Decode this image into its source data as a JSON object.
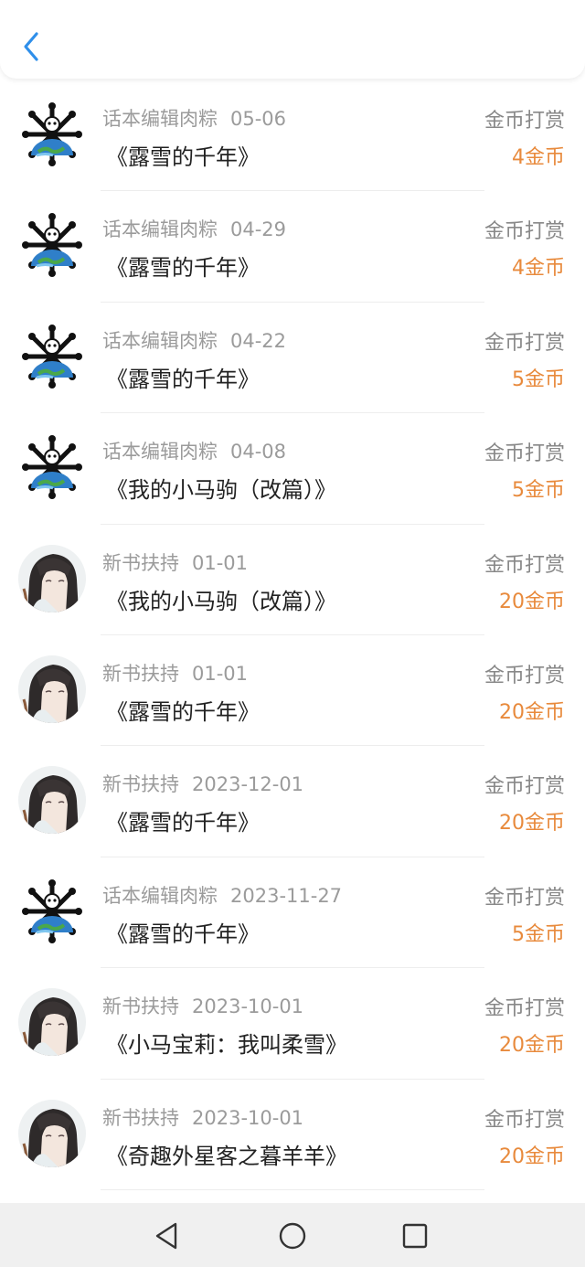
{
  "header": {
    "back_icon": "chevron-left-icon"
  },
  "colors": {
    "accent": "#2f8fea",
    "amount": "#e88a3c",
    "meta": "#9b9b9b"
  },
  "rewards": [
    {
      "avatar": "skull-globe-avatar",
      "sender": "话本编辑肉粽",
      "date": "05-06",
      "book": "《露雪的千年》",
      "type": "金币打赏",
      "amount": "4金币"
    },
    {
      "avatar": "skull-globe-avatar",
      "sender": "话本编辑肉粽",
      "date": "04-29",
      "book": "《露雪的千年》",
      "type": "金币打赏",
      "amount": "4金币"
    },
    {
      "avatar": "skull-globe-avatar",
      "sender": "话本编辑肉粽",
      "date": "04-22",
      "book": "《露雪的千年》",
      "type": "金币打赏",
      "amount": "5金币"
    },
    {
      "avatar": "skull-globe-avatar",
      "sender": "话本编辑肉粽",
      "date": "04-08",
      "book": "《我的小马驹（改篇）》",
      "type": "金币打赏",
      "amount": "5金币"
    },
    {
      "avatar": "anime-portrait-avatar",
      "sender": "新书扶持",
      "date": "01-01",
      "book": "《我的小马驹（改篇）》",
      "type": "金币打赏",
      "amount": "20金币"
    },
    {
      "avatar": "anime-portrait-avatar",
      "sender": "新书扶持",
      "date": "01-01",
      "book": "《露雪的千年》",
      "type": "金币打赏",
      "amount": "20金币"
    },
    {
      "avatar": "anime-portrait-avatar",
      "sender": "新书扶持",
      "date": "2023-12-01",
      "book": "《露雪的千年》",
      "type": "金币打赏",
      "amount": "20金币"
    },
    {
      "avatar": "skull-globe-avatar",
      "sender": "话本编辑肉粽",
      "date": "2023-11-27",
      "book": "《露雪的千年》",
      "type": "金币打赏",
      "amount": "5金币"
    },
    {
      "avatar": "anime-portrait-avatar",
      "sender": "新书扶持",
      "date": "2023-10-01",
      "book": "《小马宝莉：我叫柔雪》",
      "type": "金币打赏",
      "amount": "20金币"
    },
    {
      "avatar": "anime-portrait-avatar",
      "sender": "新书扶持",
      "date": "2023-10-01",
      "book": "《奇趣外星客之暮羊羊》",
      "type": "金币打赏",
      "amount": "20金币"
    }
  ],
  "navbar": {
    "back_icon": "triangle-back-icon",
    "home_icon": "circle-home-icon",
    "recents_icon": "square-recents-icon"
  }
}
